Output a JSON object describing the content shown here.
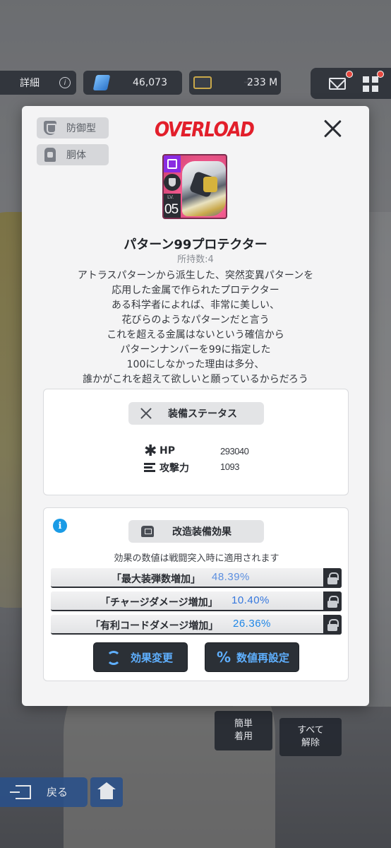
{
  "topbar": {
    "detail_label": "詳細",
    "gems": "46,073",
    "credits": "233 M"
  },
  "modal": {
    "tags": {
      "type": "防御型",
      "part": "胴体"
    },
    "logo": "OVERLOAD",
    "card": {
      "lv_label": "LV.",
      "level": "05"
    },
    "item_name": "パターン99プロテクター",
    "owned": "所持数:4",
    "description": [
      "アトラスパターンから派生した、突然変異パターンを",
      "応用した金属で作られたプロテクター",
      "ある科学者によれば、非常に美しい、",
      "花びらのようなパターンだと言う",
      "これを超える金属はないという確信から",
      "パターンナンバーを99に指定した",
      "100にしなかった理由は多分、",
      "誰かがこれを超えて欲しいと願っているからだろう"
    ],
    "stats": {
      "header": "装備ステータス",
      "hp_label": "HP",
      "hp_value": "293040",
      "atk_label": "攻撃力",
      "atk_value": "1093"
    },
    "effects": {
      "header": "改造装備効果",
      "note": "効果の数値は戦闘突入時に適用されます",
      "rows": [
        {
          "name": "「最大装弾数増加」",
          "value": "48.39%"
        },
        {
          "name": "「チャージダメージ増加」",
          "value": "10.40%"
        },
        {
          "name": "「有利コードダメージ増加」",
          "value": "26.36%"
        }
      ],
      "change_label": "効果変更",
      "reroll_label": "数値再設定"
    }
  },
  "bottom": {
    "equip_line1": "簡単",
    "equip_line2": "着用",
    "remove_line1": "すべて",
    "remove_line2": "解除",
    "back_label": "戻る"
  },
  "colors": {
    "overload_red": "#e21f2b",
    "effect_blue": "#3577dd",
    "info_blue": "#1a9be6"
  }
}
